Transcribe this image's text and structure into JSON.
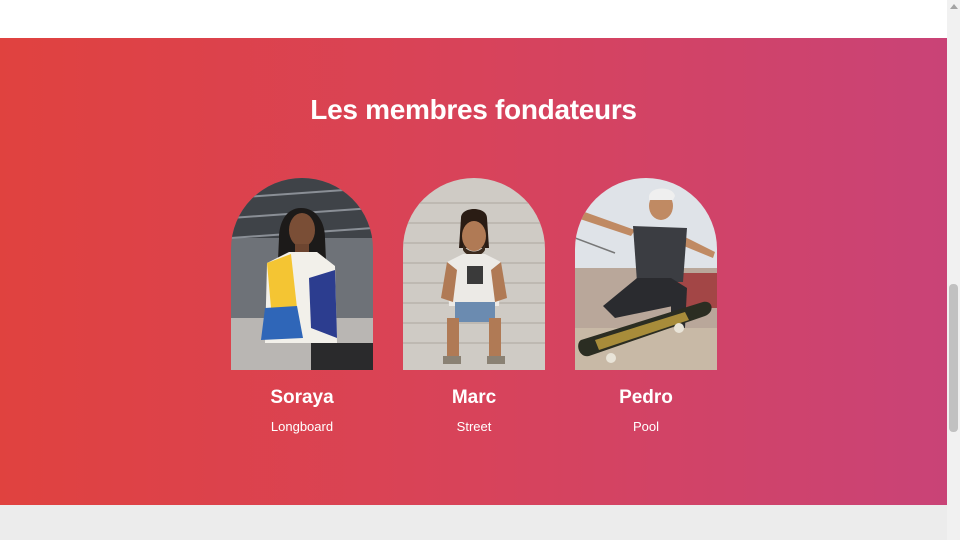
{
  "section": {
    "title": "Les membres fondateurs"
  },
  "members": [
    {
      "name": "Soraya",
      "discipline": "Longboard",
      "photo_icon": "portrait-photo"
    },
    {
      "name": "Marc",
      "discipline": "Street",
      "photo_icon": "portrait-photo"
    },
    {
      "name": "Pedro",
      "discipline": "Pool",
      "photo_icon": "skateboarder-photo"
    }
  ],
  "colors": {
    "gradient_start": "#e0423f",
    "gradient_end": "#c94377",
    "text": "#ffffff",
    "footer_band": "#ececec"
  }
}
